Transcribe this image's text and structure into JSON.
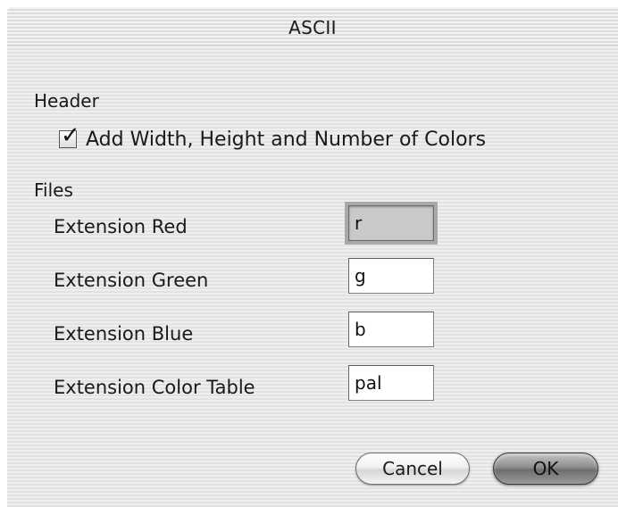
{
  "window": {
    "title": "ASCII"
  },
  "header_section": {
    "label": "Header",
    "checkbox": {
      "label": "Add Width, Height and Number of Colors",
      "checked": true
    }
  },
  "files_section": {
    "label": "Files",
    "fields": [
      {
        "label": "Extension Red",
        "value": "r",
        "focused": true
      },
      {
        "label": "Extension Green",
        "value": "g",
        "focused": false
      },
      {
        "label": "Extension Blue",
        "value": "b",
        "focused": false
      },
      {
        "label": "Extension Color Table",
        "value": "pal",
        "focused": false
      }
    ]
  },
  "buttons": {
    "cancel_label": "Cancel",
    "ok_label": "OK"
  }
}
